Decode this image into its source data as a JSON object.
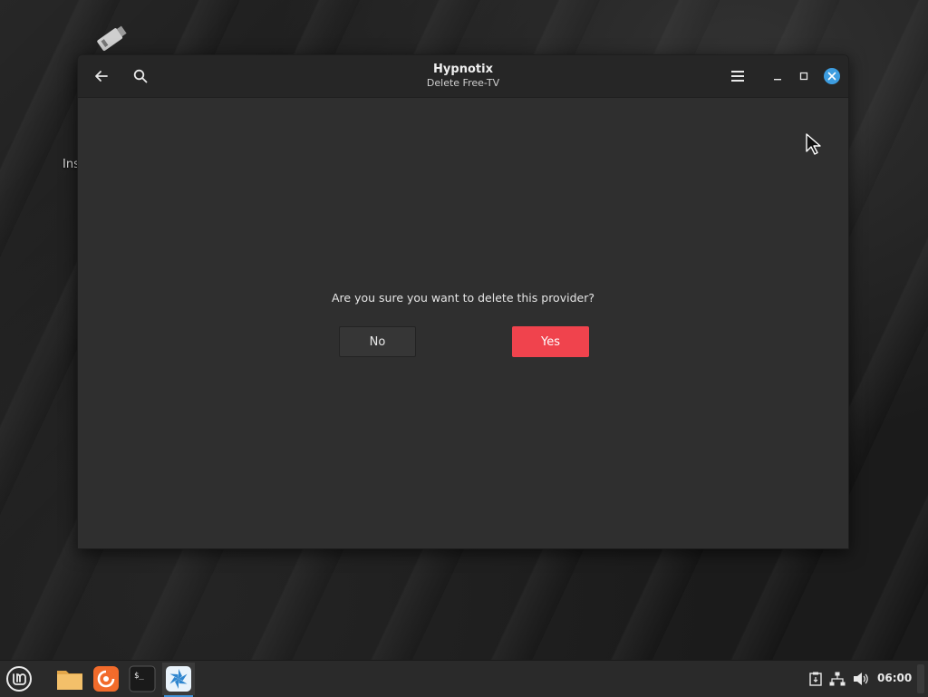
{
  "window": {
    "title": "Hypnotix",
    "subtitle": "Delete Free-TV"
  },
  "dialog": {
    "question": "Are you sure you want to delete this provider?",
    "no_label": "No",
    "yes_label": "Yes"
  },
  "desktop": {
    "label_fragment": "Ins",
    "icon": "usb-drive-icon"
  },
  "taskbar": {
    "apps": [
      "mint-menu-icon",
      "files-icon",
      "firefox-icon",
      "terminal-icon",
      "hypnotix-icon"
    ],
    "tray": [
      "clipboard-icon",
      "network-icon",
      "volume-icon"
    ],
    "clock": "06:00"
  },
  "colors": {
    "accent_destructive": "#f0434d",
    "close_button": "#3d9de0",
    "active_indicator": "#3f8fd6"
  }
}
